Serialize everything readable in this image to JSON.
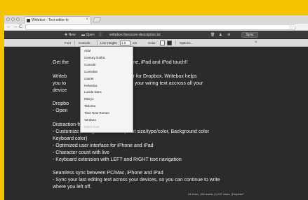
{
  "browser": {
    "tab_title": "Writebox - Text editor fo",
    "tab_close": "×",
    "nav_back": "←",
    "nav_forward": "→",
    "nav_reload": "C",
    "star": "☆"
  },
  "toolbar": {
    "new_label": "New",
    "open_label": "Open",
    "doc_title": "writebox-fixescore-description.txt",
    "sync_label": "Sync"
  },
  "options": {
    "font_label": "Font",
    "font_value": "Console",
    "line_height_label": "Line Height:",
    "line_height_value": "1.6",
    "line_height_unit": "em",
    "color_label": "Color:",
    "options_label": "Options...",
    "close": "×",
    "text_color": "#ffffff",
    "bg_color": "#2b2b2b"
  },
  "font_dropdown": [
    {
      "label": "Arial",
      "muted": false
    },
    {
      "label": "Century Gothic",
      "muted": false
    },
    {
      "label": "Console",
      "muted": false
    },
    {
      "label": "Consolas",
      "muted": false
    },
    {
      "label": "courier",
      "muted": false
    },
    {
      "label": "Helvetica",
      "muted": false
    },
    {
      "label": "Lucida Sans",
      "muted": false
    },
    {
      "label": "Meiryo",
      "muted": false
    },
    {
      "label": "Tahoma",
      "muted": false
    },
    {
      "label": "Time New Roman",
      "muted": false
    },
    {
      "label": "Verdana",
      "muted": false
    },
    {
      "label": "Other Font",
      "muted": true
    }
  ],
  "editor_lines": [
    "Get the                  ence on your iPhone, iPad and iPod touch!!",
    "",
    "Writeb                  ction-free text editor for Dropbox. Writebox helps",
    "you to                  nd seamlessly sync your wiring text accross all your",
    "device",
    "",
    "Dropbo",
    "- Open                  es on Dropbox",
    "",
    "Distraction-free writing",
    "- Customize writing environment (Font size/type/color, Background color",
    "Keyboard color)",
    "- Optimized user interface for iPhone and iPad",
    "- Character count with live",
    "- Keyboard extension with LEFT and RIGHT text navigation",
    "",
    "Seamless sync between PC/Mac, iPhone and iPad",
    "- Sync your last editing text across your devices, so you can continue to write",
    "where you left off."
  ],
  "status": "24 lines | 155 words | 1,037 chars | Dropbox*",
  "colors": {
    "accent_yellow": "#f5c400",
    "editor_bg": "#2b2b2b",
    "toolbar_bg": "#3a3a3a"
  }
}
